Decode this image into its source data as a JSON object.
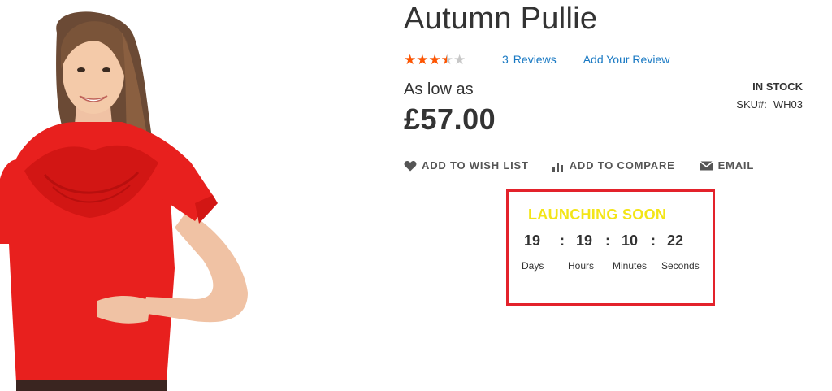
{
  "product": {
    "title": "Autumn Pullie",
    "rating": {
      "stars_filled": 3,
      "stars_total": 5,
      "star_glyphs": "★★★★★"
    },
    "reviews": {
      "count": "3",
      "label": "Reviews"
    },
    "add_review_label": "Add Your Review",
    "price_label": "As low as",
    "price": "£57.00",
    "stock_status": "IN STOCK",
    "sku": {
      "label": "SKU#:",
      "value": "WH03"
    },
    "image_alt_icon": "model-red-top-photo"
  },
  "actions": {
    "wishlist": {
      "label": "ADD TO WISH LIST",
      "icon": "heart-icon"
    },
    "compare": {
      "label": "ADD TO COMPARE",
      "icon": "bar-chart-icon"
    },
    "email": {
      "label": "EMAIL",
      "icon": "envelope-icon"
    }
  },
  "countdown": {
    "title": "LAUNCHING SOON",
    "days": "19",
    "hours": "19",
    "minutes": "10",
    "seconds": "22",
    "separator": ":",
    "labels": {
      "days": "Days",
      "hours": "Hours",
      "minutes": "Minutes",
      "seconds": "Seconds"
    }
  },
  "colors": {
    "star_filled": "#ff5501",
    "star_empty": "#c7c7c7",
    "link": "#1979c3",
    "countdown_border": "#e3222b",
    "countdown_title": "#f3e518",
    "product_red": "#e8201e"
  }
}
